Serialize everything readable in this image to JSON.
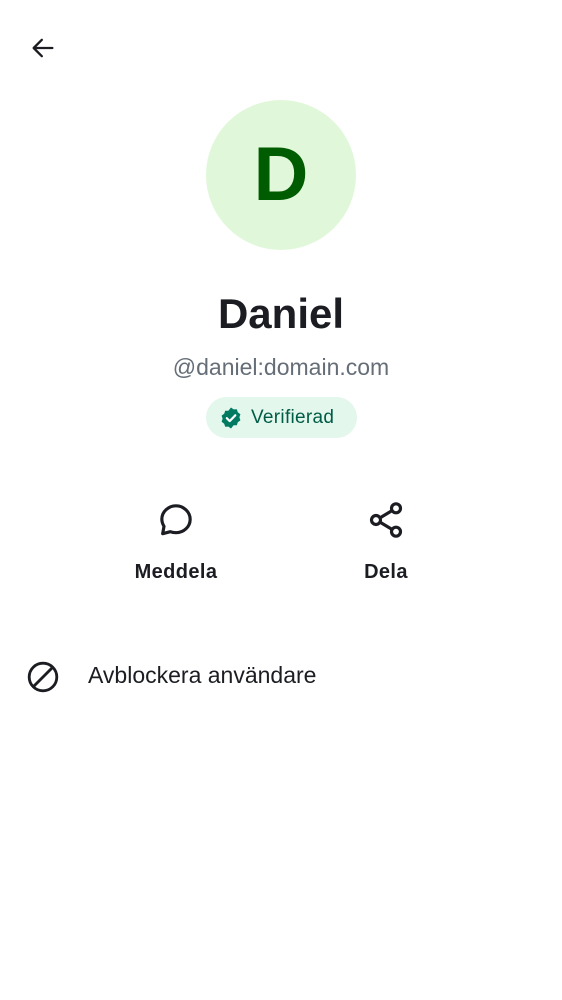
{
  "header": {
    "back_icon": "arrow-left-icon"
  },
  "profile": {
    "avatar_letter": "D",
    "display_name": "Daniel",
    "user_id": "@daniel:domain.com",
    "verified_label": "Verifierad",
    "verified_icon": "verified-shield-icon"
  },
  "actions": {
    "message": {
      "label": "Meddela",
      "icon": "chat-bubble-icon"
    },
    "share": {
      "label": "Dela",
      "icon": "share-icon"
    }
  },
  "list": {
    "unblock": {
      "label": "Avblockera användare",
      "icon": "block-icon"
    }
  },
  "colors": {
    "avatar_bg": "#e0f8d9",
    "avatar_text": "#005c00",
    "badge_bg": "#e3f7ed",
    "badge_text": "#005c45",
    "secondary_text": "#656d77",
    "primary_text": "#1b1d22"
  }
}
